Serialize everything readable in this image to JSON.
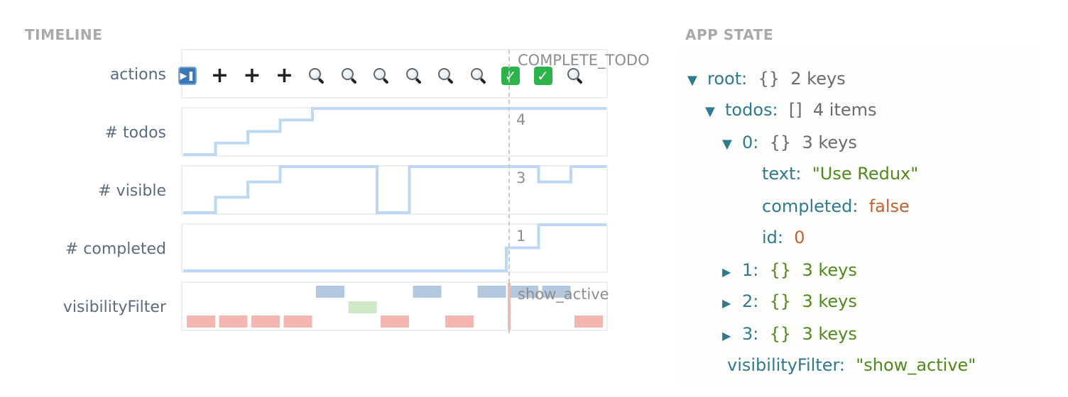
{
  "timeline": {
    "title": "TIMELINE",
    "rows": {
      "actions": "actions",
      "todos": "# todos",
      "visible": "# visible",
      "completed": "# completed",
      "filter": "visibilityFilter"
    },
    "actions": [
      "play-pause-icon",
      "add-icon",
      "add-icon",
      "add-icon",
      "search-icon",
      "search-icon",
      "search-icon",
      "search-icon",
      "search-icon",
      "search-icon",
      "complete-check-icon",
      "complete-check-icon",
      "search-icon"
    ],
    "series": {
      "todos": [
        0,
        1,
        2,
        3,
        4,
        4,
        4,
        4,
        4,
        4,
        4,
        4,
        4
      ],
      "visible": [
        0,
        1,
        2,
        3,
        3,
        3,
        0,
        3,
        3,
        3,
        3,
        2,
        3
      ],
      "completed": [
        0,
        0,
        0,
        0,
        0,
        0,
        0,
        0,
        0,
        0,
        1,
        2,
        2
      ]
    },
    "filter_states": [
      "show_all",
      "show_all",
      "show_all",
      "show_all",
      "show_active",
      "show_completed",
      "show_all",
      "show_active",
      "show_all",
      "show_active",
      "show_active",
      "show_active",
      "show_all"
    ],
    "filter_colors": {
      "show_all": "#f4b6b0",
      "show_active": "#b3c7de",
      "show_completed": "#cfe8c8"
    },
    "cursor": {
      "index": 10,
      "action_label": "COMPLETE_TODO",
      "todos_value": "4",
      "visible_value": "3",
      "completed_value": "1",
      "filter_value": "show_active"
    }
  },
  "state": {
    "title": "APP STATE",
    "root": {
      "key": "root:",
      "brace": "{}",
      "count": "2 keys"
    },
    "todos": {
      "key": "todos:",
      "brace": "[]",
      "count": "4 items"
    },
    "item0": {
      "key": "0:",
      "brace": "{}",
      "count": "3 keys"
    },
    "text": {
      "key": "text:",
      "value": "\"Use Redux\""
    },
    "completed": {
      "key": "completed:",
      "value": "false"
    },
    "id": {
      "key": "id:",
      "value": "0"
    },
    "item1": {
      "key": "1:",
      "brace": "{}",
      "count": "3 keys"
    },
    "item2": {
      "key": "2:",
      "brace": "{}",
      "count": "3 keys"
    },
    "item3": {
      "key": "3:",
      "brace": "{}",
      "count": "3 keys"
    },
    "visibilityFilter": {
      "key": "visibilityFilter:",
      "value": "\"show_active\""
    }
  },
  "colors": {
    "line": "#bcd8f5",
    "accent": "#2e7b8f"
  }
}
